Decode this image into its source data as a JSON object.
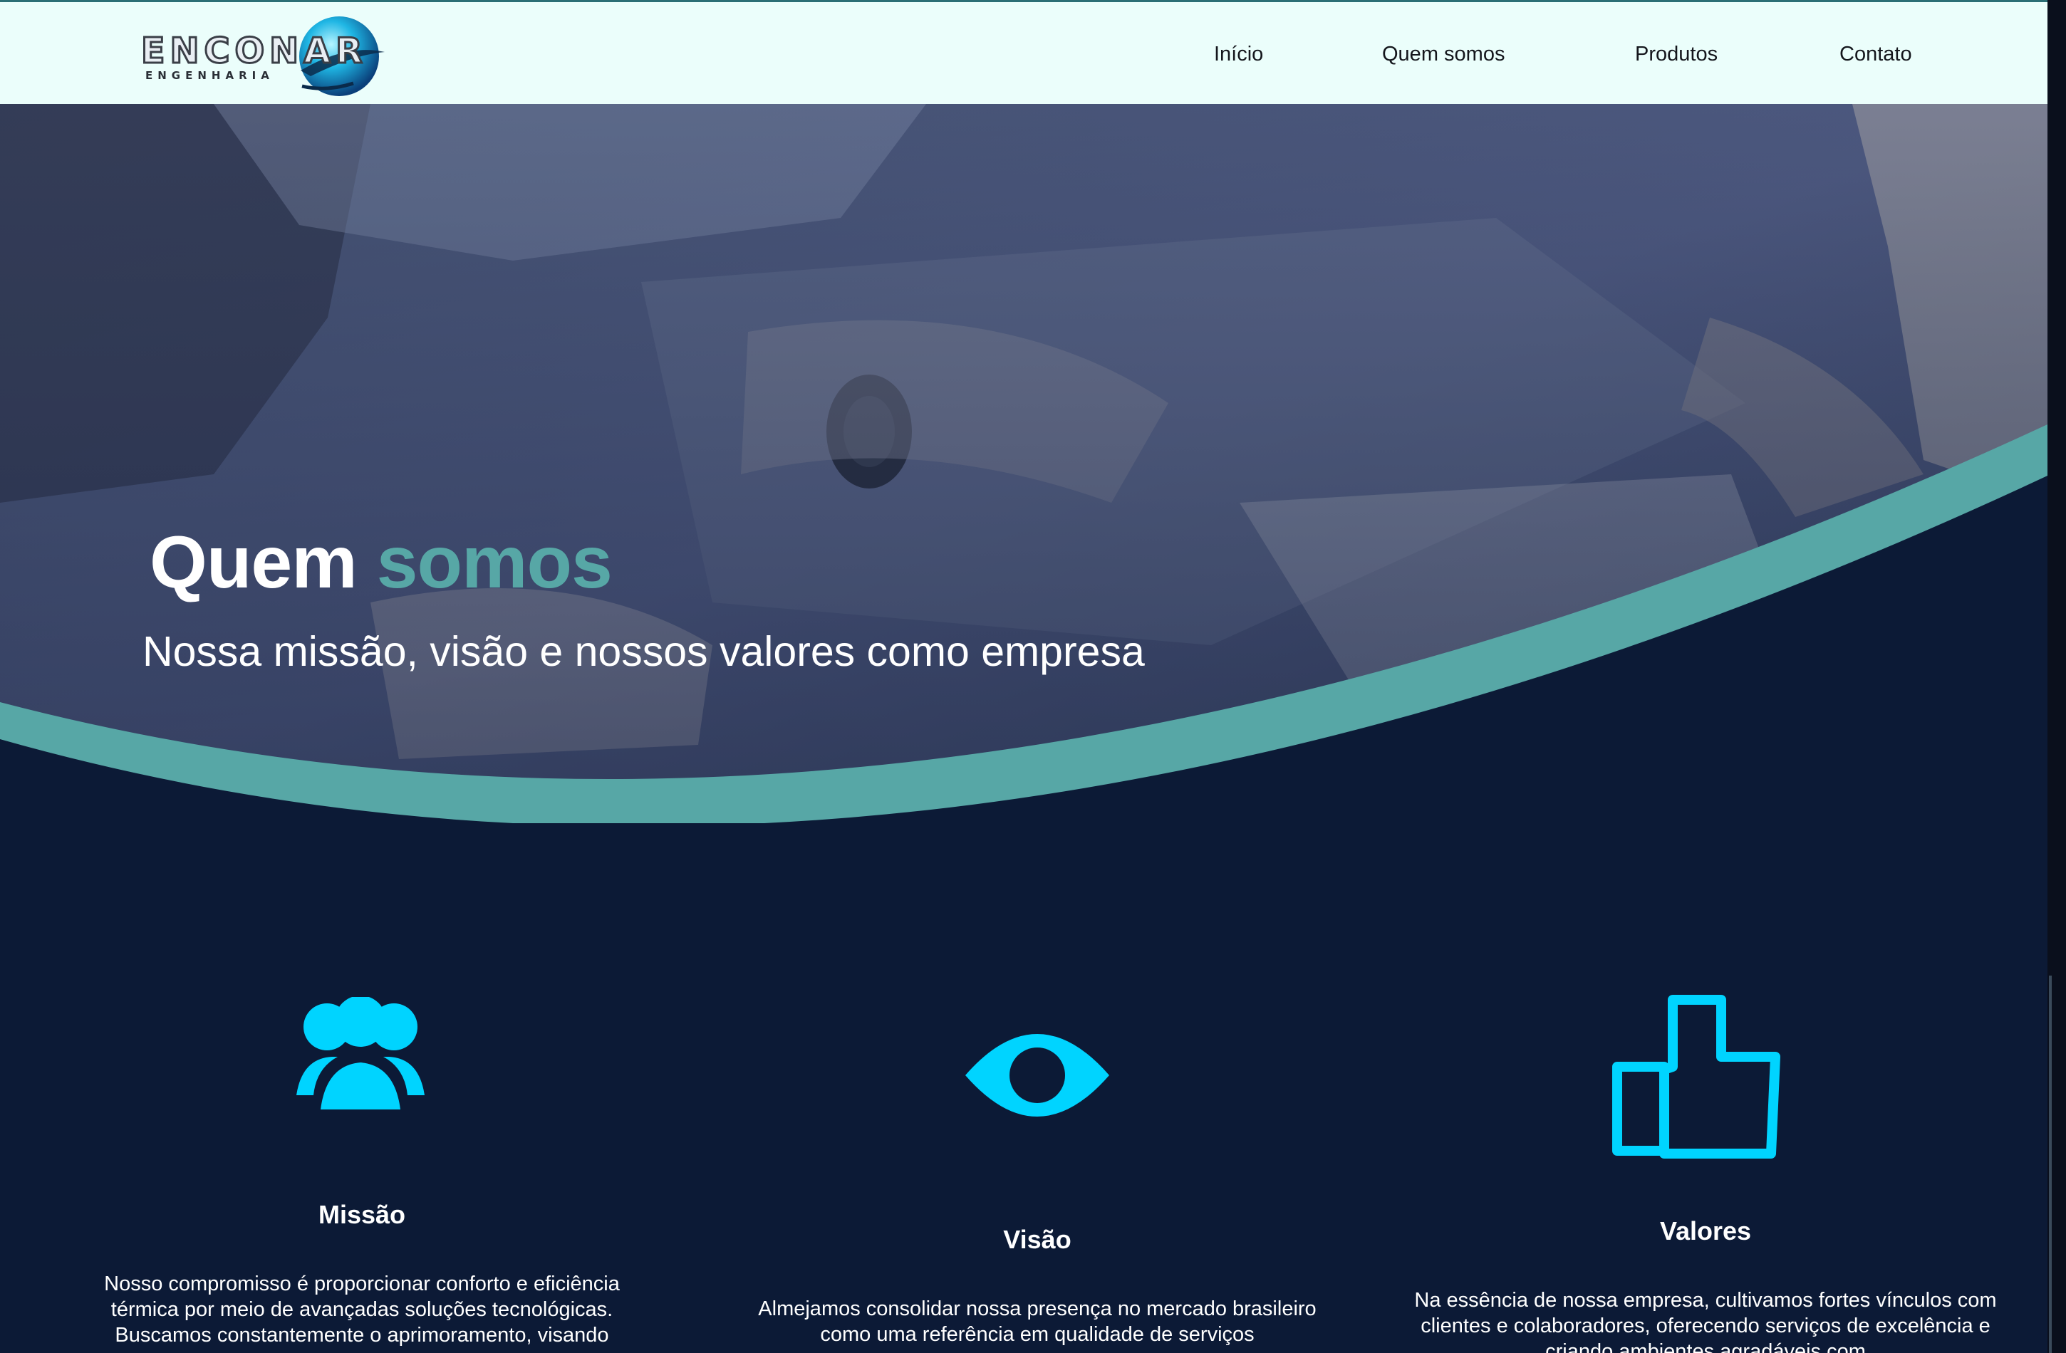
{
  "brand": {
    "name": "ENCONAR",
    "tagline": "ENGENHARIA"
  },
  "nav": {
    "items": [
      "Início",
      "Quem somos",
      "Produtos",
      "Contato"
    ]
  },
  "hero": {
    "title_main": "Quem",
    "title_accent": "somos",
    "subtitle": "Nossa missão, visão e nossos valores como empresa"
  },
  "sections": {
    "missao": {
      "icon": "team-icon",
      "title": "Missão",
      "text": "Nosso compromisso é proporcionar conforto e eficiência térmica por meio de avançadas soluções tecnológicas. Buscamos constantemente o aprimoramento, visando"
    },
    "visao": {
      "icon": "eye-icon",
      "title": "Visão",
      "text": "Almejamos consolidar nossa presença no mercado brasileiro como uma referência em qualidade de serviços"
    },
    "valores": {
      "icon": "thumbs-up-icon",
      "title": "Valores",
      "text": "Na essência de nossa empresa, cultivamos fortes vínculos com clientes e colaboradores, oferecendo serviços de excelência e criando ambientes agradáveis com"
    }
  },
  "colors": {
    "nav_bg": "#ebfefb",
    "accent_teal": "#57a7a6",
    "dark_navy": "#0c1a36",
    "icon_cyan": "#00d4ff"
  }
}
